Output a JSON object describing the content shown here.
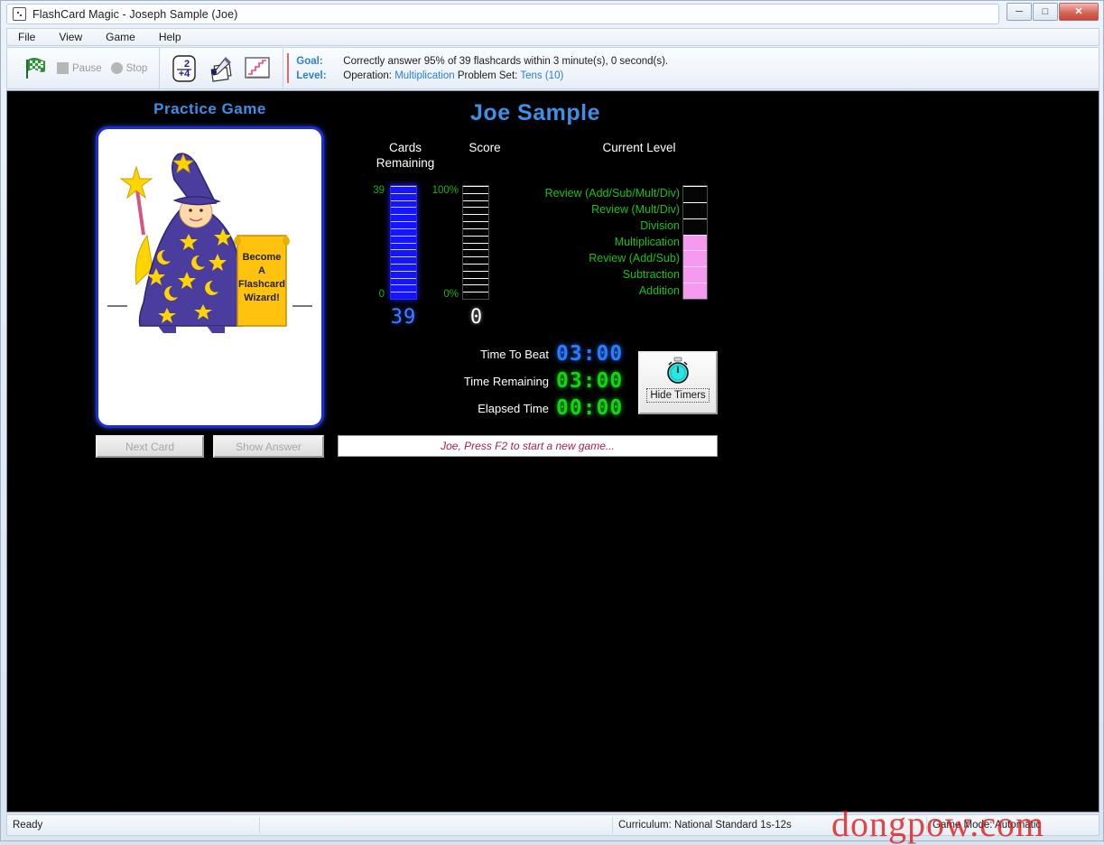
{
  "window": {
    "title": "FlashCard Magic - Joseph  Sample (Joe)",
    "app_icon": "flashcard-app-icon",
    "minimize_glyph": "─",
    "maximize_glyph": "□",
    "close_glyph": "✕"
  },
  "menu": {
    "items": [
      {
        "label": "File"
      },
      {
        "label": "View"
      },
      {
        "label": "Game"
      },
      {
        "label": "Help"
      }
    ]
  },
  "toolbar": {
    "start_icon": "checkered-flag-icon",
    "pause_icon": "pause-square-icon",
    "pause_label": "Pause",
    "stop_icon": "stop-circle-icon",
    "stop_label": "Stop",
    "flashcard_icon": "addition-card-icon",
    "flashcard_icon_top": "2",
    "flashcard_icon_bottom": "+4",
    "edit_cards_icon": "pencil-cards-icon",
    "report_icon": "progress-chart-icon",
    "goal_key": "Goal:",
    "goal_text": "Correctly answer 95% of 39 flashcards within 3 minute(s), 0 second(s).",
    "level_key": "Level:",
    "level_prefix": "Operation:",
    "level_operation": "Multiplication",
    "level_mid": "Problem Set:",
    "level_problem_set": "Tens (10)"
  },
  "game": {
    "practice_title": "Practice Game",
    "player_name": "Joe Sample",
    "card_scroll_text_line1": "Become",
    "card_scroll_text_line2": "A",
    "card_scroll_text_line3": "Flashcard",
    "card_scroll_text_line4": "Wizard!",
    "columns": {
      "cards_remaining": "Cards\nRemaining",
      "cards_remaining_line1": "Cards",
      "cards_remaining_line2": "Remaining",
      "score": "Score",
      "current_level": "Current Level"
    },
    "cards_meter": {
      "top_label": "39",
      "bottom_label": "0",
      "value": "39",
      "filled_segments": 16,
      "total_segments": 16,
      "color": "#1414ff"
    },
    "score_meter": {
      "top_label": "100%",
      "bottom_label": "0%",
      "value": "0",
      "filled_segments": 0,
      "total_segments": 16,
      "color": "#ffffff"
    },
    "level_meter": {
      "filled_segments": 4,
      "total_segments": 7,
      "color": "#f49bf0"
    },
    "levels": [
      {
        "label": "Review (Add/Sub/Mult/Div)"
      },
      {
        "label": "Review (Mult/Div)"
      },
      {
        "label": "Division"
      },
      {
        "label": "Multiplication"
      },
      {
        "label": "Review (Add/Sub)"
      },
      {
        "label": "Subtraction"
      },
      {
        "label": "Addition"
      }
    ],
    "timers": [
      {
        "label": "Time To Beat",
        "value": "03:00",
        "color": "#2c7bff"
      },
      {
        "label": "Time Remaining",
        "value": "03:00",
        "color": "#12d412"
      },
      {
        "label": "Elapsed Time",
        "value": "00:00",
        "color": "#12d412"
      }
    ],
    "hide_timers": {
      "icon": "stopwatch-icon",
      "label": "Hide Timers"
    },
    "next_card_label": "Next Card",
    "show_answer_label": "Show Answer",
    "message": "Joe, Press F2 to start a new game..."
  },
  "statusbar": {
    "ready": "Ready",
    "curriculum": "Curriculum: National Standard 1s-12s",
    "game_mode": "Game Mode: Automatic"
  },
  "watermark": "dongpow.com"
}
